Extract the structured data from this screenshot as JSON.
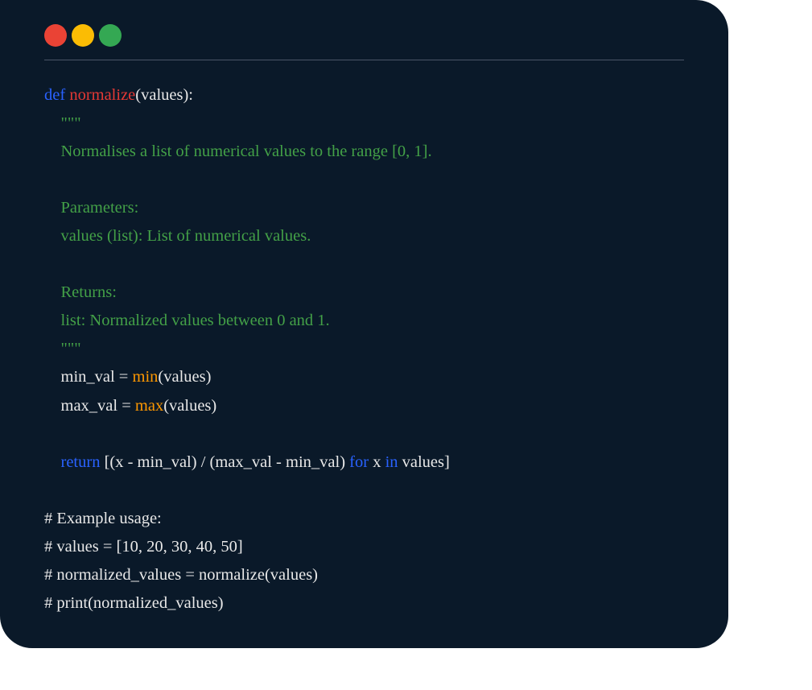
{
  "code": {
    "line1": {
      "def": "def",
      "space1": " ",
      "funcname": "normalize",
      "params": "(values):"
    },
    "line2": "    \"\"\"",
    "line3": "    Normalises a list of numerical values to the range [0, 1].",
    "line4": "",
    "line5": "    Parameters:",
    "line6": "    values (list): List of numerical values.",
    "line7": "",
    "line8": "    Returns:",
    "line9": "    list: Normalized values between 0 and 1.",
    "line10": "    \"\"\"",
    "line11a": "    min_val = ",
    "line11b": "min",
    "line11c": "(values)",
    "line12a": "    max_val = ",
    "line12b": "max",
    "line12c": "(values)",
    "line13": "",
    "line14a": "    ",
    "line14b": "return",
    "line14c": " [(x - min_val) / (max_val - min_val) ",
    "line14d": "for",
    "line14e": " x ",
    "line14f": "in",
    "line14g": " values]",
    "line15": "",
    "line16": "# Example usage:",
    "line17": "# values = [10, 20, 30, 40, 50]",
    "line18": "# normalized_values = normalize(values)",
    "line19": "# print(normalized_values)"
  }
}
